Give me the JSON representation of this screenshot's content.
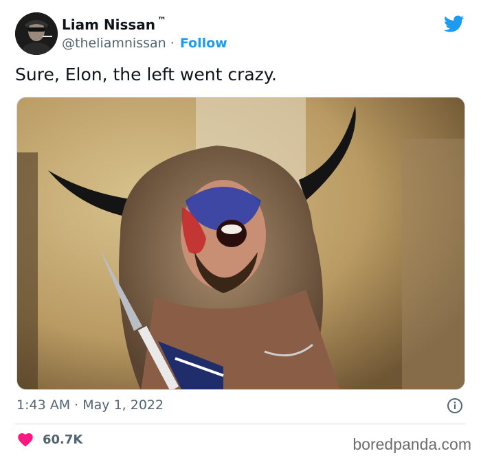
{
  "tweet": {
    "author_name": "Liam Nissan",
    "author_mark": "™",
    "handle": "@theliamnissan",
    "separator": "·",
    "follow_label": "Follow",
    "text": "Sure, Elon, the left went crazy.",
    "time": "1:43 AM",
    "date": "May 1, 2022",
    "likes": "60.7K"
  },
  "icons": {
    "platform": "twitter-bird-icon",
    "info": "info-icon",
    "like": "heart-icon"
  },
  "colors": {
    "accent": "#1d9bf0",
    "like": "#f91880",
    "secondary_text": "#536471"
  },
  "watermark": "boredpanda.com"
}
